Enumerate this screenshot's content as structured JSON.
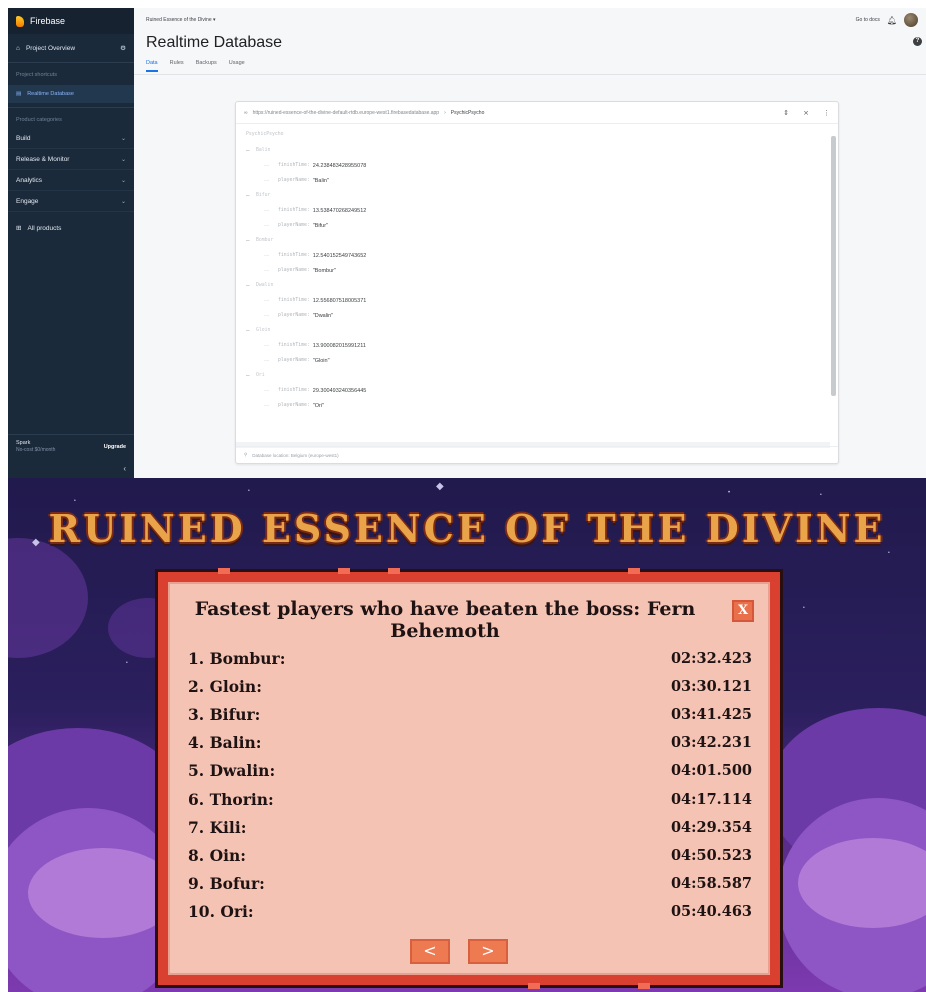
{
  "firebase": {
    "brand": "Firebase",
    "sidebar": {
      "project_overview": "Project Overview",
      "project_shortcuts": "Project shortcuts",
      "realtime_database": "Realtime Database",
      "product_categories": "Product categories",
      "categories": [
        "Build",
        "Release & Monitor",
        "Analytics",
        "Engage"
      ],
      "all_products": "All products",
      "plan_name": "Spark",
      "plan_detail": "No-cost $0/month",
      "upgrade": "Upgrade"
    },
    "topbar": {
      "project_name": "Ruined Essence of the Divine",
      "go_to_docs": "Go to docs"
    },
    "page_title": "Realtime Database",
    "tabs": [
      "Data",
      "Rules",
      "Backups",
      "Usage"
    ],
    "database": {
      "url": "https://ruined-essence-of-the-divine-default-rtdb.europe-west1.firebasedatabase.app",
      "breadcrumb_node": "PsychicPsycho",
      "root": "PsychicPsycho",
      "entries": [
        {
          "key": "Balin",
          "finishTime": "24.238483428955078",
          "playerName": "\"Balin\""
        },
        {
          "key": "Bifur",
          "finishTime": "13.538470268249512",
          "playerName": "\"Bifur\""
        },
        {
          "key": "Bombur",
          "finishTime": "12.540152549743652",
          "playerName": "\"Bombur\""
        },
        {
          "key": "Dwalin",
          "finishTime": "12.556807518005371",
          "playerName": "\"Dwalin\""
        },
        {
          "key": "Gloin",
          "finishTime": "13.900082015991211",
          "playerName": "\"Gloin\""
        },
        {
          "key": "Ori",
          "finishTime": "29.300493240356445",
          "playerName": "\"Ori\""
        }
      ],
      "field_finish": "finishTime:",
      "field_player": "playerName:",
      "footer": "Database location: Belgium (europe-west1)"
    }
  },
  "game": {
    "title": "RUINED ESSENCE OF THE DIVINE",
    "heading": "Fastest players who have beaten the boss: Fern Behemoth",
    "close_label": "X",
    "leaderboard": [
      {
        "name": "1. Bombur:",
        "time": "02:32.423"
      },
      {
        "name": "2. Gloin:",
        "time": "03:30.121"
      },
      {
        "name": "3. Bifur:",
        "time": "03:41.425"
      },
      {
        "name": "4. Balin:",
        "time": "03:42.231"
      },
      {
        "name": "5. Dwalin:",
        "time": "04:01.500"
      },
      {
        "name": "6. Thorin:",
        "time": "04:17.114"
      },
      {
        "name": "7. Kili:",
        "time": "04:29.354"
      },
      {
        "name": "8. Oin:",
        "time": "04:50.523"
      },
      {
        "name": "9. Bofur:",
        "time": "04:58.587"
      },
      {
        "name": "10. Ori:",
        "time": "05:40.463"
      }
    ],
    "prev_label": "<",
    "next_label": ">",
    "colors": {
      "sky": "#2b1f5e",
      "frame": "#d9402f",
      "paper": "#f4c3b4",
      "title": "#e9a44a",
      "button": "#ee7a52"
    }
  }
}
